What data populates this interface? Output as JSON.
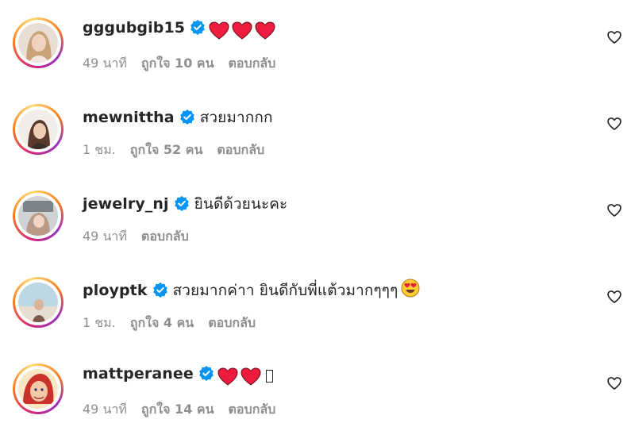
{
  "colors": {
    "text": "#262626",
    "meta": "#8e8e8e",
    "verified": "#0095f6",
    "heart": "#ed1c3f"
  },
  "comments": [
    {
      "username": "gggubgib15",
      "text": "",
      "hearts": 3,
      "time": "49 นาที",
      "likes": "ถูกใจ 10 คน",
      "reply": "ตอบกลับ"
    },
    {
      "username": "mewnittha",
      "text": "สวยมากกก",
      "hearts": 0,
      "time": "1 ชม.",
      "likes": "ถูกใจ 52 คน",
      "reply": "ตอบกลับ"
    },
    {
      "username": "jewelry_nj",
      "text": "ยินดีด้วยนะคะ",
      "hearts": 0,
      "time": "49 นาที",
      "likes": "",
      "reply": "ตอบกลับ"
    },
    {
      "username": "ployptk",
      "text": "สวยมากค่าา ยินดีกับพี่แต้วมากๆๆๆ",
      "hearts": 0,
      "time": "1 ชม.",
      "likes": "ถูกใจ 4 คน",
      "reply": "ตอบกลับ"
    },
    {
      "username": "mattperanee",
      "text": "",
      "hearts": 2,
      "time": "49 นาที",
      "likes": "ถูกใจ 14 คน",
      "reply": "ตอบกลับ"
    }
  ]
}
